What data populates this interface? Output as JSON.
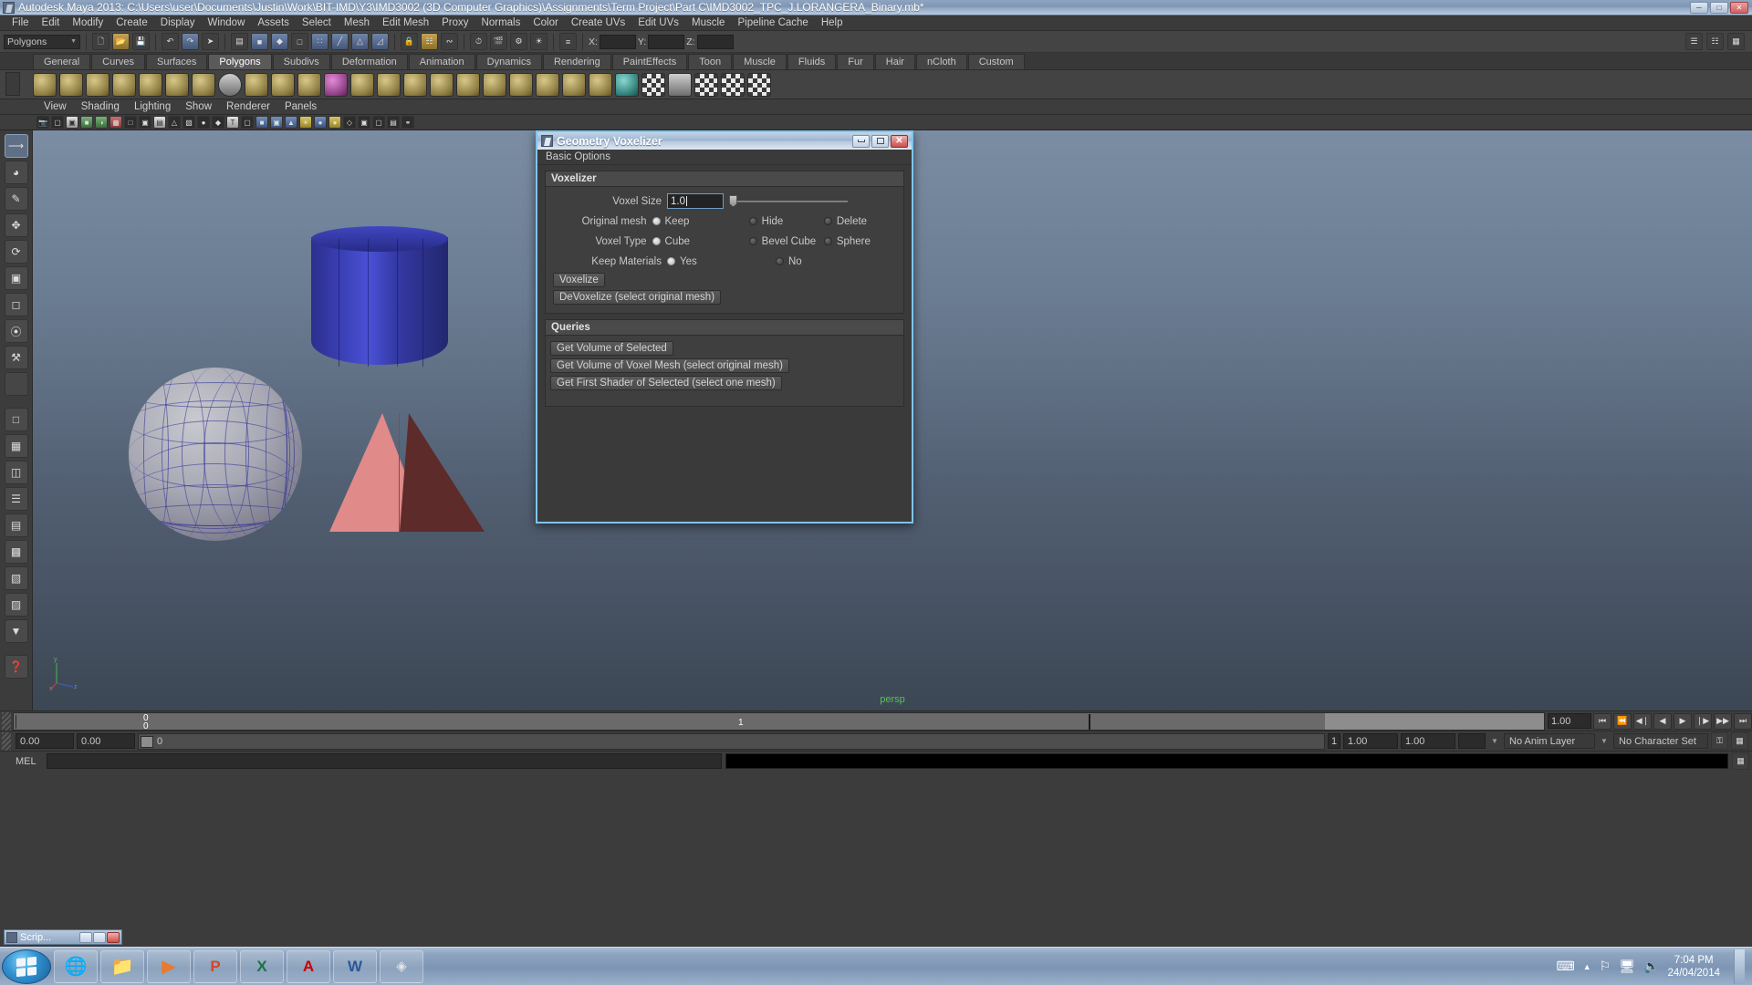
{
  "window": {
    "title": "Autodesk Maya 2013: C:\\Users\\user\\Documents\\Justin\\Work\\BIT-IMD\\Y3\\IMD3002 (3D Computer Graphics)\\Assignments\\Term Project\\Part C\\IMD3002_TPC_J.LORANGERA_Binary.mb*",
    "minimize": "—",
    "maximize": "□",
    "close": "✕"
  },
  "menubar": {
    "items": [
      "File",
      "Edit",
      "Modify",
      "Create",
      "Display",
      "Window",
      "Assets",
      "Select",
      "Mesh",
      "Edit Mesh",
      "Proxy",
      "Normals",
      "Color",
      "Create UVs",
      "Edit UVs",
      "Muscle",
      "Pipeline Cache",
      "Help"
    ]
  },
  "status_row": {
    "selection_mode": "Polygons",
    "coords": [
      {
        "axis": "X:",
        "value": ""
      },
      {
        "axis": "Y:",
        "value": ""
      },
      {
        "axis": "Z:",
        "value": ""
      }
    ]
  },
  "shelf": {
    "tabs": [
      "General",
      "Curves",
      "Surfaces",
      "Polygons",
      "Subdivs",
      "Deformation",
      "Animation",
      "Dynamics",
      "Rendering",
      "PaintEffects",
      "Toon",
      "Muscle",
      "Fluids",
      "Fur",
      "Hair",
      "nCloth",
      "Custom"
    ],
    "active_tab": "Polygons",
    "icon_count": 29
  },
  "panel": {
    "menu": [
      "View",
      "Shading",
      "Lighting",
      "Show",
      "Renderer",
      "Panels"
    ],
    "camera_label": "persp",
    "axis": {
      "y": "y",
      "x": "x",
      "z": "z"
    }
  },
  "dialog": {
    "title": "Geometry Voxelizer",
    "menu": [
      "Basic Options"
    ],
    "titlebar_buttons": {
      "minimize": "",
      "maximize": "",
      "close": "✕"
    },
    "groups": [
      {
        "name": "Voxelizer",
        "fields": [
          {
            "label": "Voxel Size",
            "type": "text",
            "value": "1.0"
          }
        ],
        "radio_rows": [
          {
            "label": "Original mesh",
            "options": [
              {
                "text": "Keep",
                "selected": true
              },
              {
                "text": "Hide",
                "selected": false
              },
              {
                "text": "Delete",
                "selected": false
              }
            ]
          },
          {
            "label": "Voxel Type",
            "options": [
              {
                "text": "Cube",
                "selected": true
              },
              {
                "text": "Bevel Cube",
                "selected": false
              },
              {
                "text": "Sphere",
                "selected": false
              }
            ]
          },
          {
            "label": "Keep Materials",
            "options": [
              {
                "text": "Yes",
                "selected": true
              },
              {
                "text": "No",
                "selected": false
              }
            ]
          }
        ],
        "buttons": [
          "Voxelize",
          "DeVoxelize (select original mesh)"
        ]
      },
      {
        "name": "Queries",
        "fields": [],
        "radio_rows": [],
        "buttons": [
          "Get Volume of Selected",
          "Get Volume of Voxel Mesh (select original mesh)",
          "Get First Shader of Selected (select one mesh)"
        ]
      }
    ]
  },
  "timeline": {
    "current_frame_top": "0",
    "current_frame_bottom": "0",
    "end_label": "1",
    "playback_speed": "1.00",
    "transport": [
      "⏮",
      "⏪",
      "◀❘",
      "◀",
      "▶",
      "❘▶",
      "▶▶",
      "⏭"
    ]
  },
  "range_row": {
    "start": "0.00",
    "end": "0.00",
    "range_field": "0",
    "anim_start": "1",
    "anim_end": "1.00",
    "anim_end2": "1.00",
    "anim_layer": "No Anim Layer",
    "character_set": "No Character Set"
  },
  "mel": {
    "label": "MEL",
    "input_value": "",
    "output_value": ""
  },
  "script_window": {
    "title": "Scrip...",
    "buttons": [
      "—",
      "□",
      "✕"
    ]
  },
  "taskbar": {
    "start": "start",
    "items": [
      {
        "name": "internet-explorer",
        "glyph": "🔵"
      },
      {
        "name": "file-explorer",
        "glyph": "📁"
      },
      {
        "name": "media-player",
        "glyph": "▶"
      },
      {
        "name": "powerpoint",
        "glyph": "P"
      },
      {
        "name": "excel",
        "glyph": "X"
      },
      {
        "name": "adobe-reader",
        "glyph": "A"
      },
      {
        "name": "word",
        "glyph": "W"
      },
      {
        "name": "maya",
        "glyph": "M"
      }
    ],
    "tray_icons": [
      "keyboard",
      "show-hidden",
      "network-flag",
      "network",
      "volume"
    ],
    "time": "7:04 PM",
    "date": "24/04/2014"
  },
  "colors": {
    "accent": "#7fc4ee",
    "dialog_bg": "#3a3a3a",
    "maya_grey": "#3c3c3c",
    "viewport_top": "#7b8da3",
    "viewport_bottom": "#3c4754",
    "cylinder": "#3a40b4",
    "pyramid": "#e08a8a",
    "persp_green": "#5bbf5b"
  }
}
